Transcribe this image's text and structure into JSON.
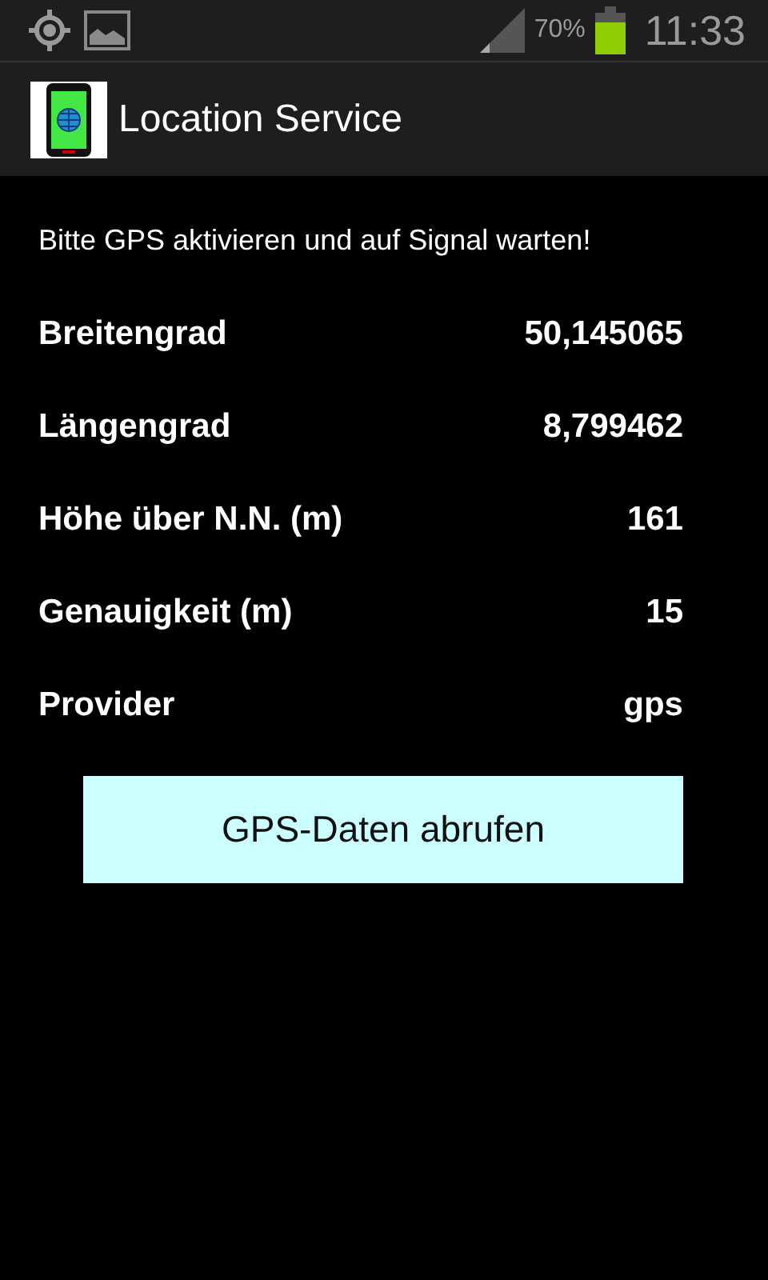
{
  "status_bar": {
    "battery_text": "70%",
    "time": "11:33"
  },
  "action_bar": {
    "title": "Location Service"
  },
  "hint": "Bitte GPS aktivieren und auf Signal warten!",
  "rows": [
    {
      "label": "Breitengrad",
      "value": "50,145065"
    },
    {
      "label": "Längengrad",
      "value": "8,799462"
    },
    {
      "label": "Höhe über N.N. (m)",
      "value": "161"
    },
    {
      "label": "Genauigkeit (m)",
      "value": "15"
    },
    {
      "label": "Provider",
      "value": "gps"
    }
  ],
  "button": "GPS-Daten abrufen"
}
